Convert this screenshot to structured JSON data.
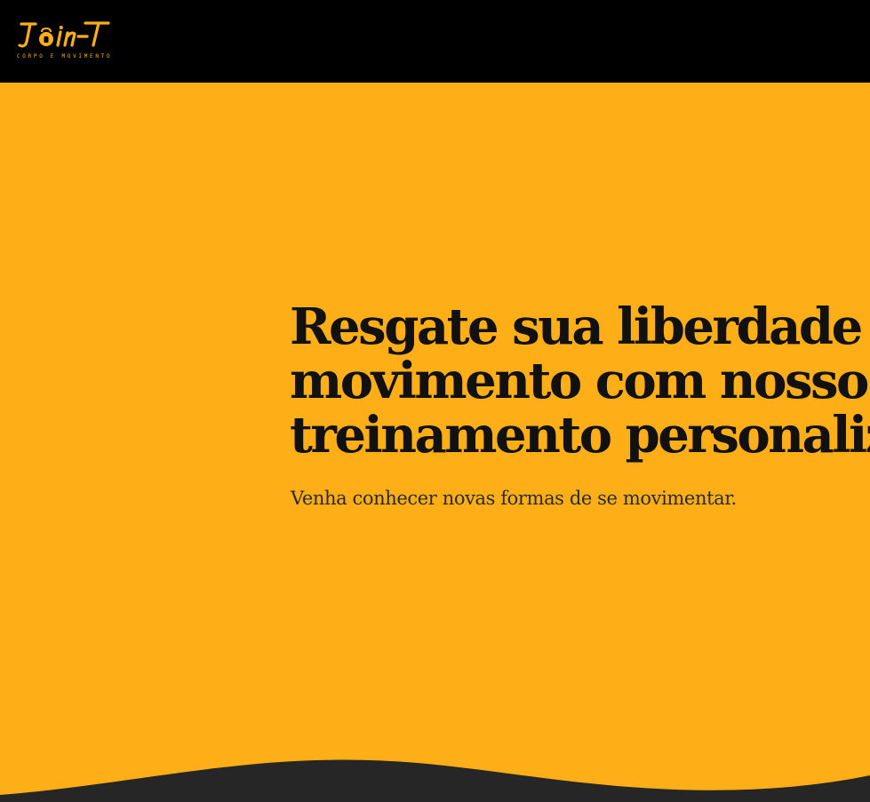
{
  "brand": {
    "logo_text": "Join-T",
    "tagline": "CORPO E MOVIMENTO",
    "color": "#feaf17"
  },
  "hero": {
    "title_lines": [
      "Resgate sua liberdade de",
      "movimento com nosso",
      "treinamento personalizado"
    ],
    "subtitle": "Venha conhecer novas formas de se movimentar.",
    "background": "#feaf17",
    "text_color": "#111111"
  },
  "header": {
    "background": "#000000"
  },
  "wave": {
    "color": "#262626"
  }
}
